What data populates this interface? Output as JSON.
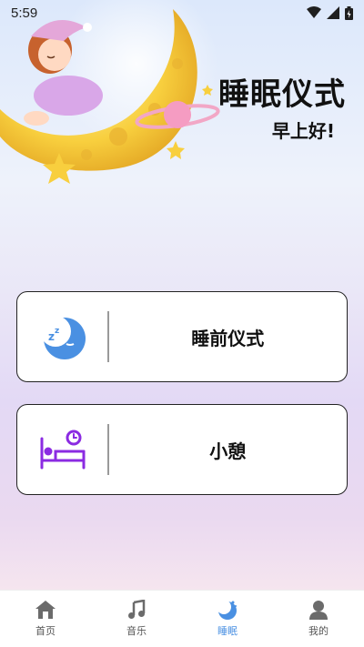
{
  "status_bar": {
    "time": "5:59"
  },
  "hero": {
    "title": "睡眠仪式",
    "greeting": "早上好!"
  },
  "cards": [
    {
      "label": "睡前仪式",
      "icon": "sleepy-moon-icon"
    },
    {
      "label": "小憩",
      "icon": "bed-alarm-icon"
    }
  ],
  "tabs": [
    {
      "label": "首页",
      "icon": "home-icon",
      "active": false
    },
    {
      "label": "音乐",
      "icon": "music-note-icon",
      "active": false
    },
    {
      "label": "睡眠",
      "icon": "moon-icon",
      "active": true
    },
    {
      "label": "我的",
      "icon": "user-icon",
      "active": false
    }
  ],
  "colors": {
    "accent": "#4a90e2",
    "bed_icon": "#8b2be2"
  }
}
